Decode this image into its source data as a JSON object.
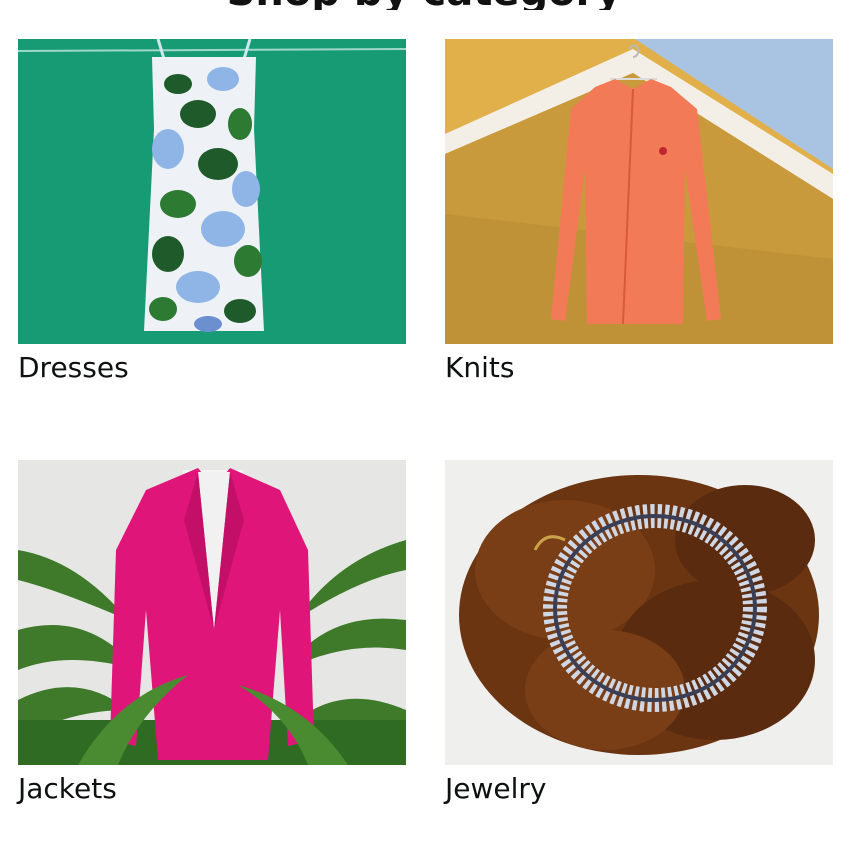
{
  "page": {
    "heading": "Shop by category"
  },
  "categories": [
    {
      "label": "Dresses",
      "image": "floral-dress-on-green-backdrop"
    },
    {
      "label": "Knits",
      "image": "coral-cardigan-on-hanger"
    },
    {
      "label": "Jackets",
      "image": "pink-blazer-with-palm-fronds"
    },
    {
      "label": "Jewelry",
      "image": "crystal-necklace-on-brown-feathers"
    }
  ],
  "colors": {
    "dresses_bg": "#1aa27c",
    "knits_wall": "#e2b04b",
    "jackets_blazer": "#e0157a",
    "jewelry_feathers": "#6b3512"
  }
}
